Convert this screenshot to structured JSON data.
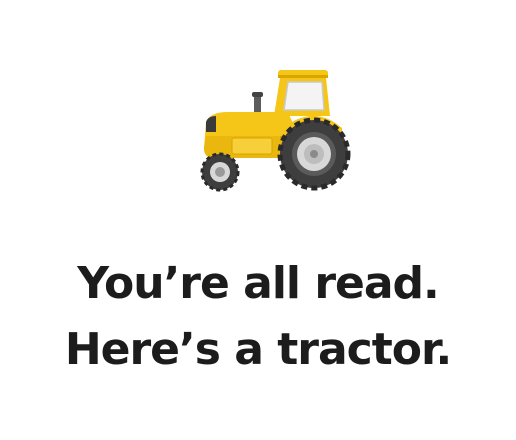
{
  "empty_state": {
    "icon": "tractor-icon",
    "line1": "You’re all read.",
    "line2": "Here’s a tractor."
  },
  "colors": {
    "text": "#1d1c1d",
    "tractor_body": "#f5c518",
    "tractor_shadow": "#d9a600",
    "tire": "#4a4a4a",
    "hub": "#d8d8d8"
  }
}
